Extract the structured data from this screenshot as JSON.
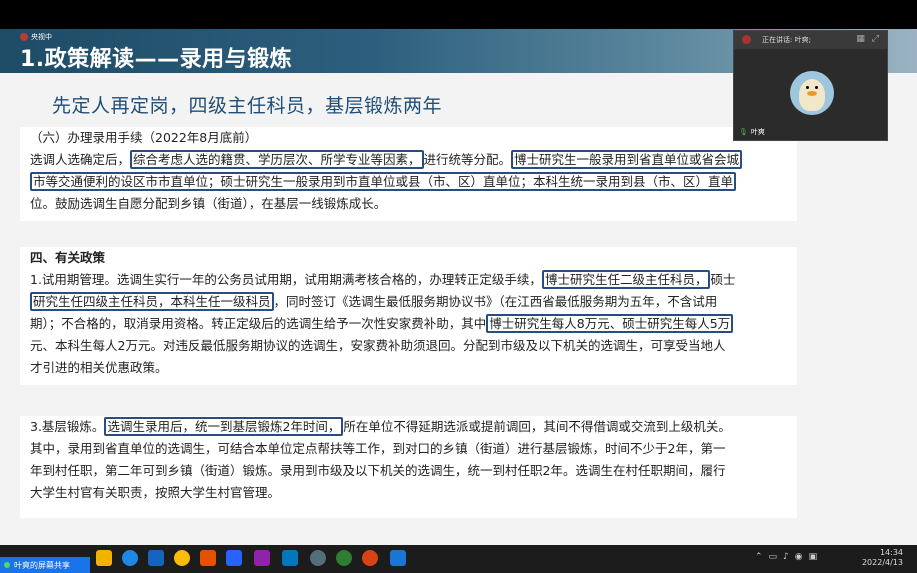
{
  "slide": {
    "logo_text": "央视中",
    "title": "1.政策解读——录用与锻炼",
    "subtitle": "先定人再定岗，四级主任科员，基层锻炼两年",
    "block1": {
      "line1": "（六）办理录用手续（2022年8月底前）",
      "line2a": "选调人选确定后，",
      "line2b": "综合考虑人选的籍贯、学历层次、所学专业等因素，",
      "line2c": "进行统等分配。",
      "line2d": "博士研究生一般录用到省直单位或省会城",
      "line3a": "市等交通便利的设区市市直单位；硕士研究生一般录用到市直单位或县（市、区）直单位；本科生统一录用到县（市、区）直单",
      "line4": "位。鼓励选调生自愿分配到乡镇（街道），在基层一线锻炼成长。"
    },
    "block2": {
      "heading": "四、有关政策",
      "line1a": "1.试用期管理。选调生实行一年的公务员试用期，试用期满考核合格的，办理转正定级手续，",
      "line1b": "博士研究生任二级主任科员，",
      "line1c": "硕士",
      "line2a": "研究生任四级主任科员，本科生任一级科员",
      "line2b": "，同时签订《选调生最低服务期协议书》（在江西省最低服务期为五年，不含试用",
      "line3a": "期）；不合格的，取消录用资格。转正定级后的选调生给予一次性安家费补助，其中",
      "line3b": "博士研究生每人8万元、硕士研究生每人5万",
      "line4": "元、本科生每人2万元。对违反最低服务期协议的选调生，安家费补助须退回。分配到市级及以下机关的选调生，可享受当地人",
      "line5": "才引进的相关优惠政策。"
    },
    "block3": {
      "line1a": "3.基层锻炼。",
      "line1b": "选调生录用后，统一到基层锻炼2年时间，",
      "line1c": "所在单位不得延期选派或提前调回，其间不得借调或交流到上级机关。",
      "line2": "其中，录用到省直单位的选调生，可结合本单位定点帮扶等工作，到对口的乡镇（街道）进行基层锻炼，时间不少于2年，第一",
      "line3": "年到村任职，第二年可到乡镇（街道）锻炼。录用到市级及以下机关的选调生，统一到村任职2年。选调生在村任职期间，履行",
      "line4": "大学生村官有关职责，按照大学生村官管理。"
    }
  },
  "video": {
    "speaker_status": "正在讲话: 叶爽;",
    "participant_name": "叶爽",
    "icons": [
      "grid-icon",
      "expand-icon"
    ]
  },
  "taskbar": {
    "share_label": "叶爽的屏幕共享",
    "time": "14:34",
    "date": "2022/4/13"
  },
  "colors": {
    "title_bar": "#1e4b66",
    "subtitle": "#1f4e79",
    "highlight_border": "#2a4d7f",
    "share_bar": "#1a73e8"
  }
}
